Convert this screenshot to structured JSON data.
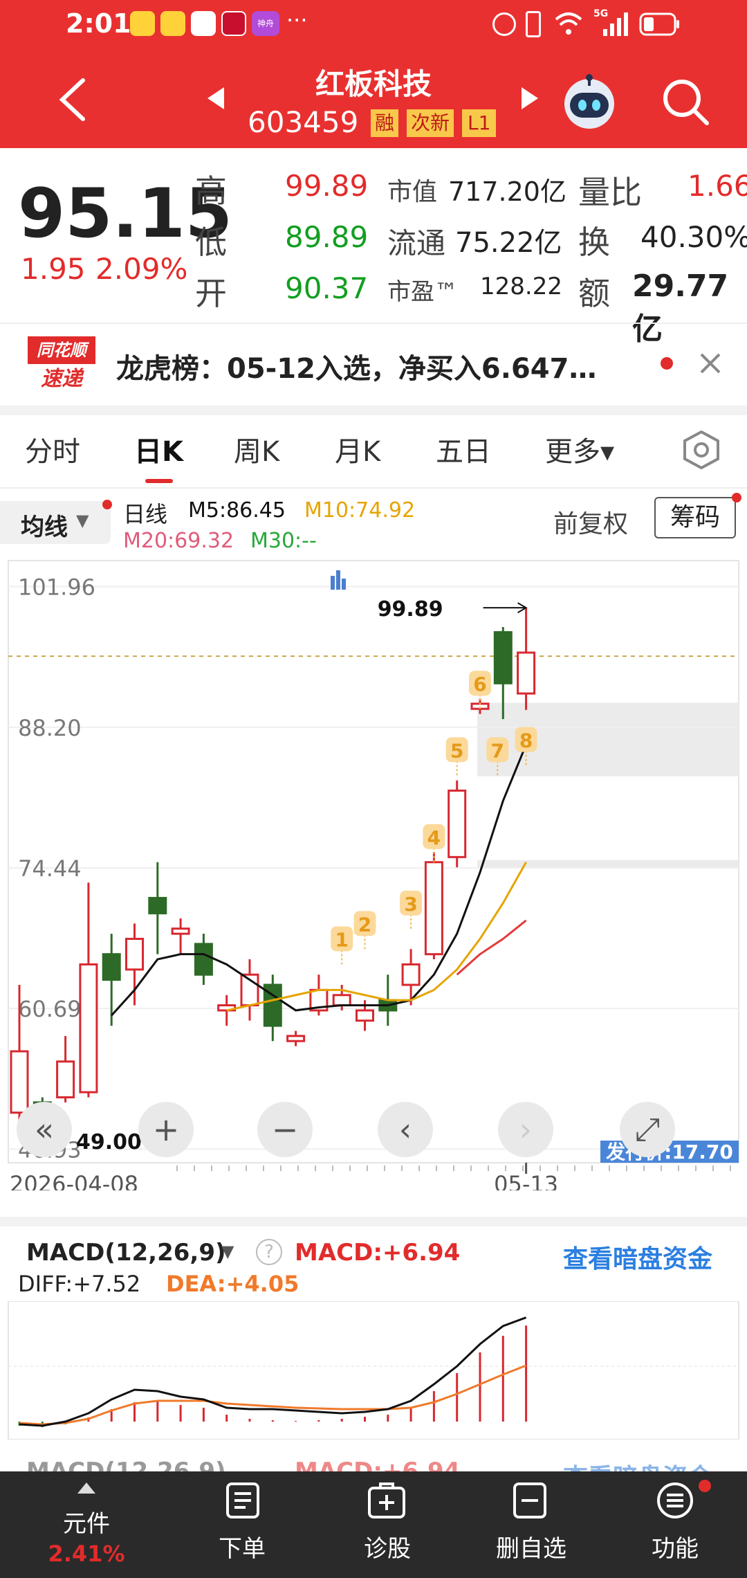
{
  "status_bar": {
    "time": "2:01",
    "app_icons": [
      "weibo-icon",
      "weibo-icon",
      "avatar-icon",
      "gift-icon",
      "app-icon"
    ],
    "small_app_text": "神舟",
    "more": "···",
    "signal": "5G",
    "right_icons": [
      "alarm-icon",
      "vibrate-icon",
      "wifi-icon",
      "signal-icon",
      "battery-icon"
    ]
  },
  "header": {
    "title": "红板科技",
    "code": "603459",
    "badges": [
      "融",
      "次新",
      "L1"
    ]
  },
  "quote": {
    "price": "95.15",
    "change": "1.95",
    "change_pct": "2.09%",
    "high_label": "高",
    "high": "99.89",
    "low_label": "低",
    "low": "89.89",
    "open_label": "开",
    "open": "90.37",
    "mkt_cap_label": "市值",
    "mkt_cap": "717.20亿",
    "float_label": "流通",
    "float": "75.22亿",
    "pe_label": "市盈™",
    "pe": "128.22",
    "vol_ratio_label": "量比",
    "vol_ratio": "1.66",
    "turnover_label": "换",
    "turnover": "40.30%",
    "amount_label": "额",
    "amount": "29.77亿"
  },
  "news": {
    "logo_top": "同花顺",
    "logo_bottom": "速递",
    "text": "龙虎榜：05-12入选，净买入6.647…"
  },
  "tabs": [
    "分时",
    "日K",
    "周K",
    "月K",
    "五日",
    "更多▾"
  ],
  "active_tab": 1,
  "indicator": {
    "ma_label": "均线",
    "line_label": "日线",
    "m5": "M5:86.45",
    "m10": "M10:74.92",
    "m20": "M20:69.32",
    "m30": "M30:--",
    "fq_label": "前复权",
    "chips_label": "筹码"
  },
  "chart_data": {
    "type": "candlestick",
    "y_ticks": [
      "101.96",
      "88.20",
      "74.44",
      "60.69",
      "46.93"
    ],
    "x_ticks": [
      "2026-04-08",
      "05-13"
    ],
    "high_marker": "99.89",
    "low_marker": "49.00",
    "ipo_label": "发行价:17.70",
    "signal_labels": [
      "1",
      "2",
      "3",
      "4",
      "5",
      "6",
      "7",
      "8"
    ],
    "candles": [
      {
        "o": 50.5,
        "c": 56.5,
        "h": 63.0,
        "l": 48.5
      },
      {
        "o": 51.5,
        "c": 50.0,
        "h": 52.0,
        "l": 49.0
      },
      {
        "o": 52.0,
        "c": 55.5,
        "h": 58.0,
        "l": 51.5
      },
      {
        "o": 52.5,
        "c": 65.0,
        "h": 73.0,
        "l": 52.0
      },
      {
        "o": 66.0,
        "c": 63.5,
        "h": 68.0,
        "l": 59.0
      },
      {
        "o": 64.5,
        "c": 67.5,
        "h": 69.0,
        "l": 61.0
      },
      {
        "o": 71.5,
        "c": 70.0,
        "h": 75.0,
        "l": 66.0
      },
      {
        "o": 68.0,
        "c": 68.5,
        "h": 69.5,
        "l": 66.0
      },
      {
        "o": 67.0,
        "c": 64.0,
        "h": 68.0,
        "l": 63.0
      },
      {
        "o": 60.5,
        "c": 61.0,
        "h": 62.0,
        "l": 59.0
      },
      {
        "o": 61.0,
        "c": 64.0,
        "h": 65.5,
        "l": 59.5
      },
      {
        "o": 63.0,
        "c": 59.0,
        "h": 64.0,
        "l": 57.5
      },
      {
        "o": 57.5,
        "c": 58.0,
        "h": 58.5,
        "l": 57.0
      },
      {
        "o": 60.5,
        "c": 62.5,
        "h": 64.0,
        "l": 60.0
      },
      {
        "o": 61.0,
        "c": 62.0,
        "h": 63.0,
        "l": 60.5
      },
      {
        "o": 59.5,
        "c": 60.5,
        "h": 61.5,
        "l": 58.5
      },
      {
        "o": 61.5,
        "c": 60.5,
        "h": 64.0,
        "l": 59.0
      },
      {
        "o": 63.0,
        "c": 65.0,
        "h": 66.5,
        "l": 61.0
      },
      {
        "o": 66.0,
        "c": 75.0,
        "h": 76.0,
        "l": 65.5
      },
      {
        "o": 75.5,
        "c": 82.0,
        "h": 83.0,
        "l": 74.5
      },
      {
        "o": 90.0,
        "c": 90.5,
        "h": 91.0,
        "l": 89.5
      },
      {
        "o": 97.5,
        "c": 92.5,
        "h": 98.0,
        "l": 89.0
      },
      {
        "o": 91.5,
        "c": 95.5,
        "h": 99.89,
        "l": 89.89
      }
    ],
    "ma_series": [
      {
        "name": "M5",
        "color": "#111111",
        "values": [
          null,
          null,
          null,
          null,
          60.0,
          62.5,
          65.5,
          66.0,
          66.0,
          65.0,
          63.5,
          62.0,
          60.5,
          60.8,
          61.0,
          61.0,
          61.0,
          61.5,
          64.0,
          68.0,
          74.0,
          81.0,
          86.5
        ]
      },
      {
        "name": "M10",
        "color": "#e6a400",
        "values": [
          null,
          null,
          null,
          null,
          null,
          null,
          null,
          null,
          null,
          60.5,
          61.0,
          61.5,
          62.0,
          62.5,
          62.5,
          62.0,
          61.5,
          61.5,
          62.5,
          64.5,
          67.5,
          71.0,
          75.0
        ]
      },
      {
        "name": "M20",
        "color": "#e23a3a",
        "values": [
          null,
          null,
          null,
          null,
          null,
          null,
          null,
          null,
          null,
          null,
          null,
          null,
          null,
          null,
          null,
          null,
          null,
          null,
          null,
          64.0,
          66.0,
          67.5,
          69.3
        ]
      }
    ],
    "macd": {
      "title": "MACD(12,26,9)",
      "macd_value": "MACD:+6.94",
      "diff": "DIFF:+7.52",
      "dea": "DEA:+4.05",
      "link": "查看暗盘资金",
      "hist": [
        -0.3,
        -0.4,
        -0.2,
        0.3,
        0.9,
        1.4,
        1.5,
        1.2,
        1.0,
        0.5,
        0.2,
        0.1,
        0.05,
        0.1,
        0.2,
        0.35,
        0.5,
        1.0,
        2.2,
        3.5,
        5.0,
        6.2,
        6.94
      ],
      "diff_line": [
        -0.2,
        -0.3,
        0.0,
        0.6,
        1.6,
        2.3,
        2.2,
        1.8,
        1.6,
        1.0,
        0.9,
        0.9,
        0.8,
        0.7,
        0.6,
        0.7,
        0.9,
        1.5,
        2.7,
        4.0,
        5.6,
        6.9,
        7.52
      ],
      "dea_line": [
        -0.1,
        -0.2,
        -0.1,
        0.2,
        0.8,
        1.3,
        1.5,
        1.5,
        1.5,
        1.3,
        1.2,
        1.1,
        1.0,
        0.95,
        0.9,
        0.9,
        0.9,
        1.0,
        1.4,
        2.0,
        2.7,
        3.4,
        4.05
      ]
    }
  },
  "controls": [
    "«",
    "+",
    "−",
    "‹",
    "›",
    "⤢"
  ],
  "bottom_bar": {
    "items": [
      "元件",
      "下单",
      "诊股",
      "删自选",
      "功能"
    ],
    "first_pct": "2.41%"
  }
}
